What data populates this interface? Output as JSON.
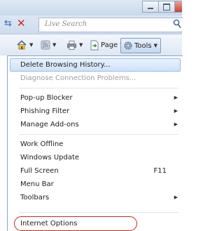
{
  "address_bar": {
    "search_placeholder": "Live Search"
  },
  "command_bar": {
    "page_label": "Page",
    "tools_label": "Tools"
  },
  "tools_menu": {
    "items": [
      {
        "label": "Delete Browsing History...",
        "enabled": true,
        "highlighted": true
      },
      {
        "label": "Diagnose Connection Problems...",
        "enabled": false
      },
      {
        "label": "Pop-up Blocker",
        "submenu": true
      },
      {
        "label": "Phishing Filter",
        "submenu": true
      },
      {
        "label": "Manage Add-ons",
        "submenu": true
      },
      {
        "label": "Work Offline"
      },
      {
        "label": "Windows Update"
      },
      {
        "label": "Full Screen",
        "shortcut": "F11"
      },
      {
        "label": "Menu Bar"
      },
      {
        "label": "Toolbars",
        "submenu": true
      },
      {
        "label": "Internet Options",
        "circled": true
      }
    ]
  },
  "colors": {
    "highlight_border": "#96bde8",
    "circle_annotation": "#c62a24",
    "disabled_text": "#a0a0a0"
  }
}
